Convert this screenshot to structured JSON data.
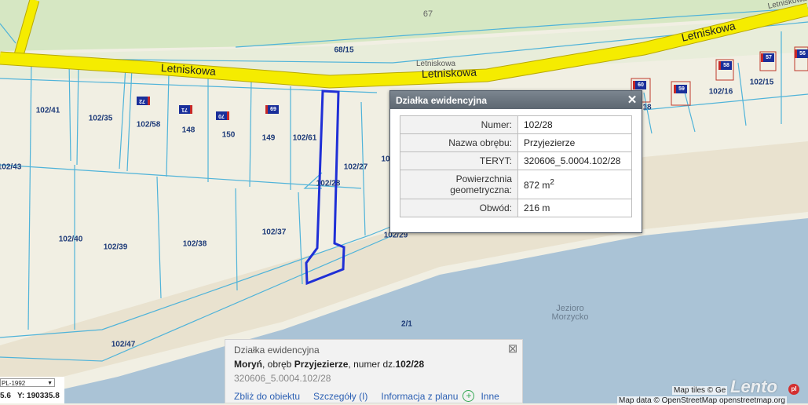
{
  "streets": {
    "letniskowa_1": "Letniskowa",
    "letniskowa_2": "Letniskowa",
    "letniskowa_3": "Letniskowa",
    "letniskowa_osm_top": "Letniskowa",
    "letniskowa_osm_mid": "Letniskowa"
  },
  "osm_labels": {
    "lot_67": "67",
    "lake_name": "Jezioro Morzycko"
  },
  "parcels": {
    "p102_41": "102/41",
    "p102_35": "102/35",
    "p102_58": "102/58",
    "p148": "148",
    "p150": "150",
    "p149": "149",
    "p102_61": "102/61",
    "p102_27": "102/27",
    "p102_28": "102/28",
    "p102_43": "102/43",
    "p102_40": "102/40",
    "p102_39": "102/39",
    "p102_38": "102/38",
    "p102_37": "102/37",
    "p102_29": "102/29",
    "p102_47": "102/47",
    "p2_1": "2/1",
    "p68_15": "68/15",
    "p102_16": "102/16",
    "p102_15": "102/15",
    "p18": "18",
    "p1c": "10"
  },
  "house_numbers": [
    "72",
    "71",
    "70",
    "69",
    "60",
    "59",
    "58",
    "57",
    "56"
  ],
  "popup": {
    "title": "Działka ewidencyjna",
    "rows": [
      {
        "key": "Numer:",
        "value": "102/28"
      },
      {
        "key": "Nazwa obrębu:",
        "value": "Przyjezierze"
      },
      {
        "key": "TERYT:",
        "value": "320606_5.0004.102/28"
      },
      {
        "key": "Powierzchnia geometryczna:",
        "value": "872 m",
        "sup": "2"
      },
      {
        "key": "Obwód:",
        "value": "216 m"
      }
    ]
  },
  "infobox": {
    "title": "Działka ewidencyjna",
    "place": "Moryń",
    "sep1": ", obręb ",
    "precinct": "Przyjezierze",
    "sep2": ", numer dz.",
    "number": "102/28",
    "teryt": "320606_5.0004.102/28",
    "links": [
      "Zbliż do obiektu",
      "Szczegóły (I)",
      "Informacja z planu",
      "Inne"
    ]
  },
  "coords": {
    "crs": "PL-1992",
    "x": "5.6",
    "y_label": "Y:",
    "y": "190335.8"
  },
  "attribution": {
    "tiles": "Map tiles © Ge",
    "data": "Map data © OpenStreetMap openstreetmap.org"
  },
  "watermark": {
    "text": "Lento",
    "badge": "pl"
  },
  "colors": {
    "road": "#f5ec00",
    "parcel_line": "#4fb3d9",
    "selected": "#1f2fd6",
    "water": "#aac3d6",
    "land": "#f1efe3"
  }
}
